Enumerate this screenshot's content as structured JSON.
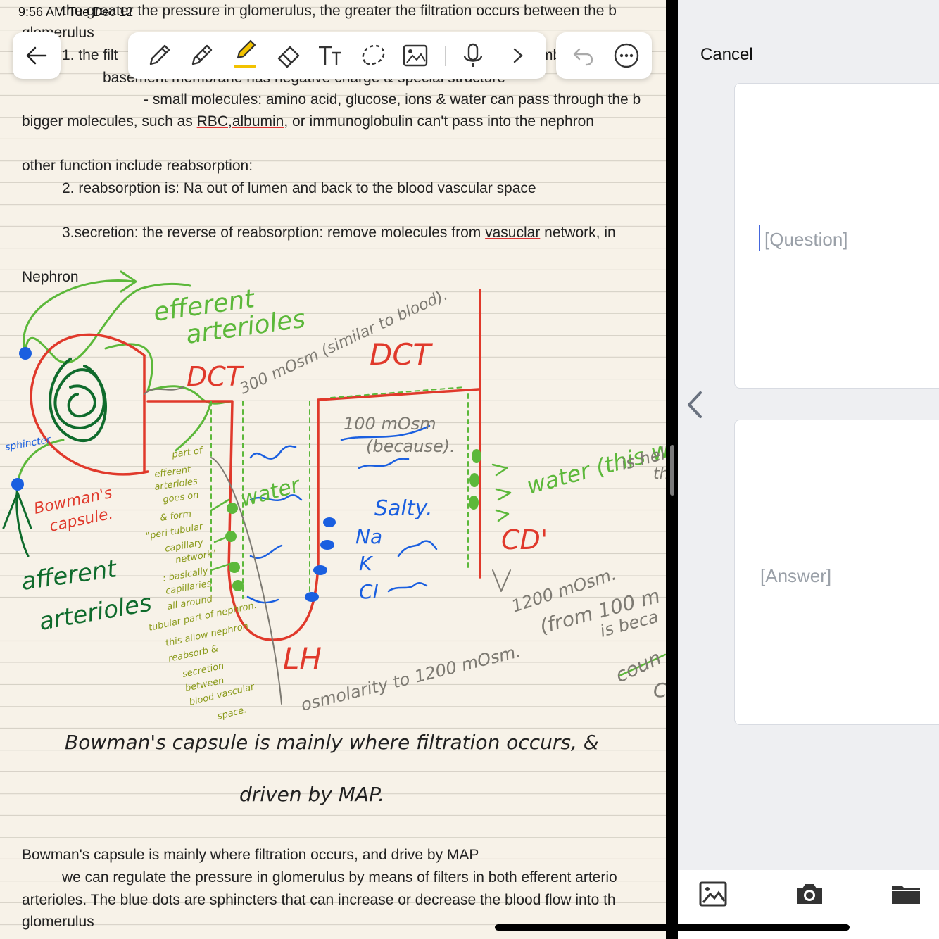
{
  "status": {
    "time": "9:56 AM",
    "date": "Tue Dec 12"
  },
  "toolbar": {
    "back_icon": "arrow-left-icon",
    "tools": [
      "pen-icon",
      "pencil-icon",
      "highlighter-icon",
      "eraser-icon",
      "text-icon",
      "lasso-icon",
      "image-icon",
      "microphone-icon",
      "chevron-right-icon"
    ],
    "active_tool": "highlighter-icon",
    "undo_icon": "undo-icon",
    "more_icon": "more-icon",
    "highlighter_color": "#f2c200"
  },
  "notes": {
    "top_lines": [
      "the greater the pressure in glomerulus, the greater the filtration occurs between the b",
      "glomerulus",
      "1. the filt",
      "mbr",
      "basement membrane has negative charge & special structure",
      "- small molecules: amino acid, glucose, ions & water can pass through the b",
      "bigger molecules, such as ",
      "RBC,albumin",
      ", or immunoglobulin can't pass into the nephron",
      "other function include reabsorption:",
      "2. reabsorption is: Na out of lumen and back to the blood vascular space",
      "3.secretion: the reverse of reabsorption: remove molecules from ",
      "vasuclar",
      " network, in",
      "Nephron"
    ],
    "handwriting": {
      "efferent": "efferent",
      "arterioles": "arterioles",
      "dct_left": "DCT",
      "dct_right": "DCT",
      "osm300": "300 mOsm (similar to blood).",
      "osm100": "100 mOsm",
      "because": "(because).",
      "salty": "Salty.",
      "water_mid": "water",
      "water_right": "water (this wat",
      "is_help": "is help",
      "th": "th",
      "cd": "CD'",
      "sphincter": "sphincter",
      "bowmans": "Bowman's",
      "capsule": "capsule.",
      "afferent": "afferent",
      "arterioles2": "arterioles",
      "na": "Na",
      "k": "K",
      "cl": "Cl",
      "lh": "LH",
      "osmolarity": "osmolarity to 1200 mOsm.",
      "osm1200": "1200 mOsm.",
      "from100": "(from 100 m",
      "is_beca": "is beca",
      "coun": "coun",
      "c": "C",
      "side_note": [
        "part of",
        "efferent",
        "arterioles",
        "goes on",
        "& form",
        "\"peri tubular",
        "capillary",
        "network\"",
        ": basically",
        "capillaries",
        "all around",
        "tubular part of nephron.",
        "this allow nephron",
        "reabsorb &",
        "secretion",
        "between",
        "blood vascular",
        "space."
      ],
      "line1": "Bowman's capsule is mainly where filtration occurs, &",
      "line2": "driven by MAP."
    },
    "bottom_lines": [
      "Bowman's capsule is mainly where filtration occurs, and drive by MAP",
      "we can regulate the pressure in glomerulus by means of filters in both efferent arterio",
      "arterioles. The blue dots are sphincters that can increase or decrease the blood flow into th",
      "glomerulus"
    ]
  },
  "flashcard_panel": {
    "cancel_label": "Cancel",
    "question_placeholder": "[Question]",
    "answer_placeholder": "[Answer]",
    "back_icon": "chevron-left-icon",
    "bottom_icons": [
      "photo-library-icon",
      "camera-icon",
      "folder-icon"
    ]
  },
  "colors": {
    "red_ink": "#e0392b",
    "green_ink": "#5cb83a",
    "dark_green_ink": "#0f6b2c",
    "blue_ink": "#1a5fe0",
    "olive_ink": "#8a9a1a",
    "gray_ink": "#7d7a72",
    "paper": "#f7f2e8"
  }
}
